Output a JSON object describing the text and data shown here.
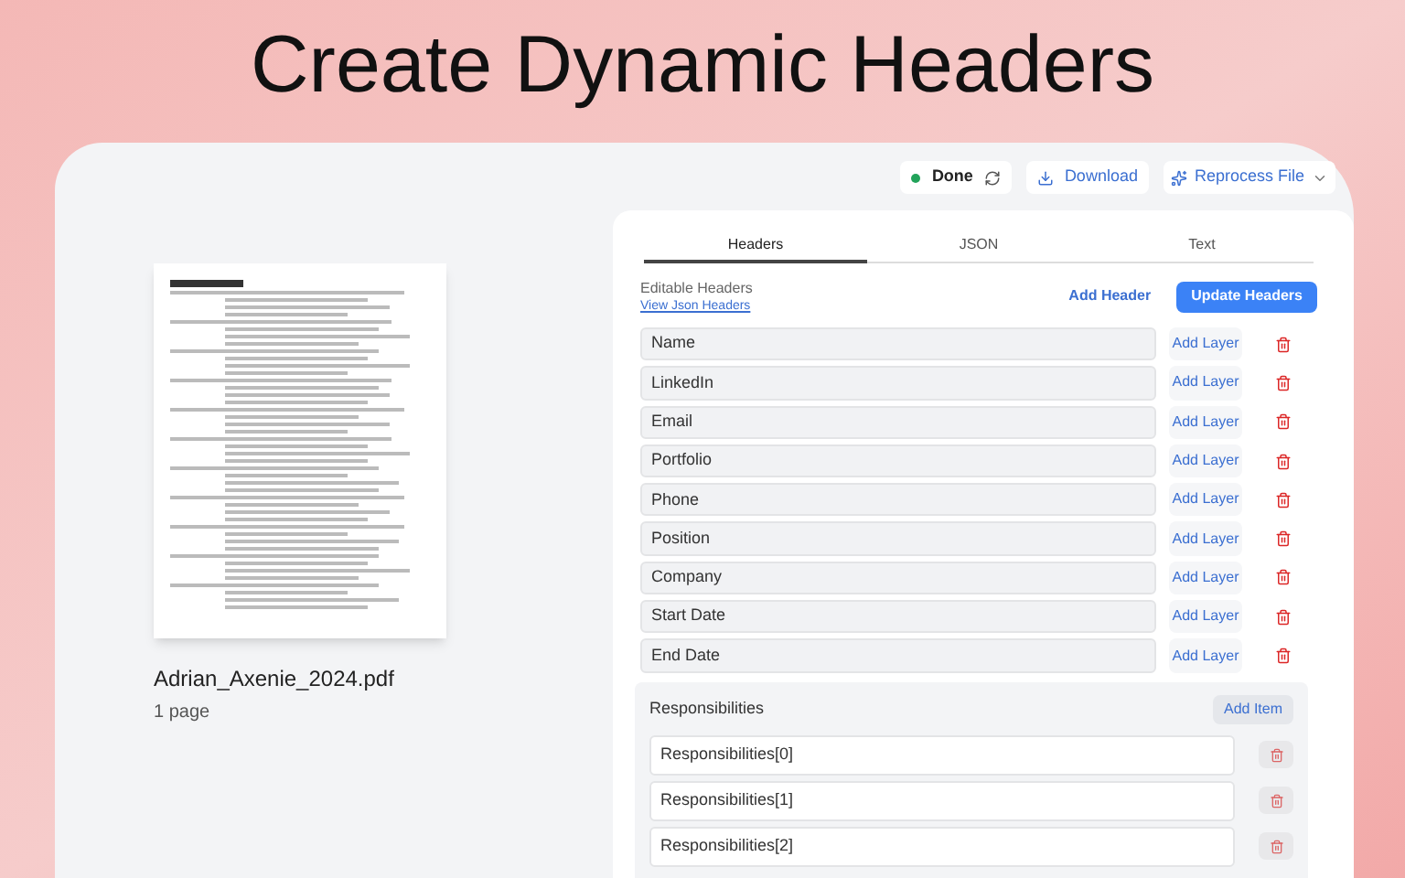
{
  "title": "Create Dynamic Headers",
  "toolbar": {
    "status": {
      "label": "Done",
      "done": true
    },
    "download": "Download",
    "reprocess": "Reprocess File"
  },
  "file": {
    "name": "Adrian_Axenie_2024.pdf",
    "pages": "1 page"
  },
  "tabs": [
    {
      "label": "Headers",
      "selected": true
    },
    {
      "label": "JSON",
      "selected": false
    },
    {
      "label": "Text",
      "selected": false
    }
  ],
  "editor": {
    "heading": "Editable Headers",
    "link": "View Json Headers",
    "add_header": "Add Header",
    "update": "Update Headers",
    "fields": [
      {
        "value": "Name",
        "action": "Add Layer"
      },
      {
        "value": "LinkedIn",
        "action": "Add Layer"
      },
      {
        "value": "Email",
        "action": "Add Layer"
      },
      {
        "value": "Portfolio",
        "action": "Add Layer"
      },
      {
        "value": "Phone",
        "action": "Add Layer"
      },
      {
        "value": "Position",
        "action": "Add Layer"
      },
      {
        "value": "Company",
        "action": "Add Layer"
      },
      {
        "value": "Start Date",
        "action": "Add Layer"
      },
      {
        "value": "End Date",
        "action": "Add Layer"
      }
    ],
    "group": {
      "label": "Responsibilities",
      "add_item": "Add Item",
      "items": [
        "Responsibilities[0]",
        "Responsibilities[1]",
        "Responsibilities[2]"
      ]
    }
  }
}
